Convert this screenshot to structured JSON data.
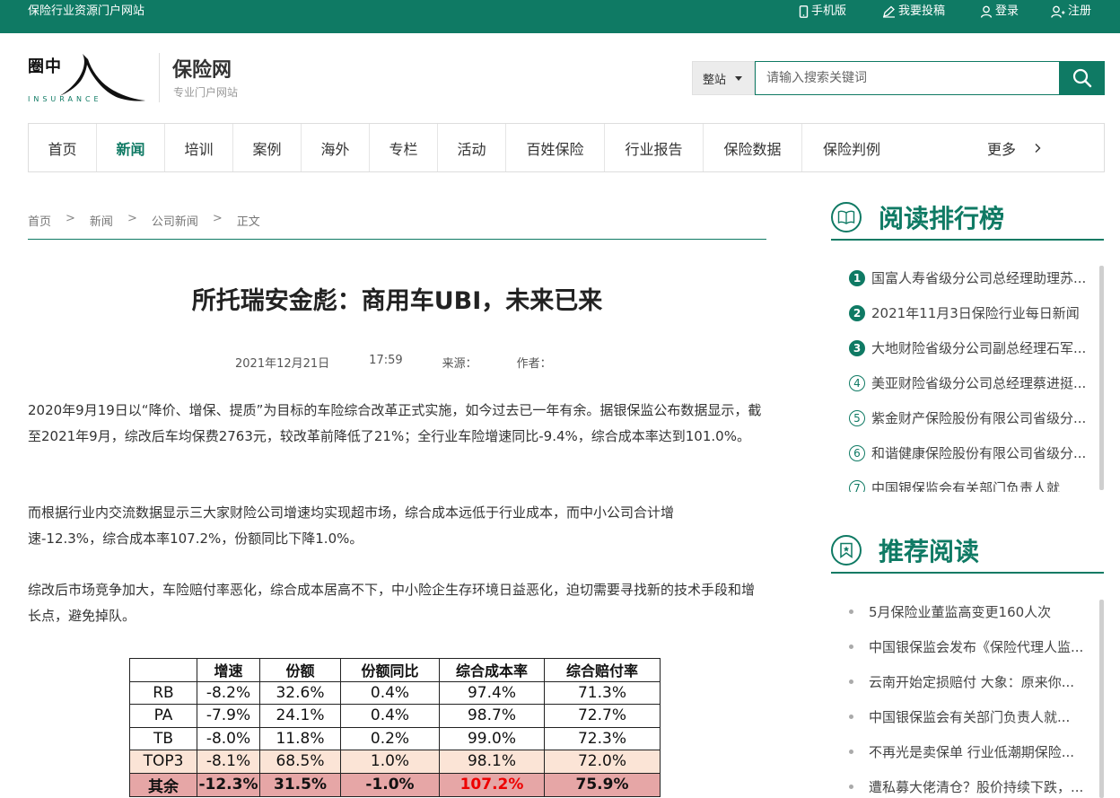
{
  "topbar": {
    "site_name": "保险行业资源门户网站",
    "links": {
      "mobile": "手机版",
      "submit": "我要投稿",
      "login": "登录",
      "register": "注册"
    }
  },
  "header": {
    "logo_text": "圈中",
    "logo_tagline": "INSURANCE",
    "brand_name": "保险网",
    "brand_sub": "专业门户网站"
  },
  "search": {
    "scope": "整站",
    "placeholder": "请输入搜索关键词"
  },
  "nav": {
    "items": [
      "首页",
      "新闻",
      "培训",
      "案例",
      "海外",
      "专栏",
      "活动",
      "百姓保险",
      "行业报告",
      "保险数据",
      "保险判例"
    ],
    "active": "新闻",
    "more": "更多"
  },
  "breadcrumb": {
    "items": [
      "首页",
      "新闻",
      "公司新闻",
      "正文"
    ],
    "separator": ">"
  },
  "article": {
    "title": "所托瑞安金彪：商用车UBI，未来已来",
    "date": "2021年12月21日",
    "time": "17:59",
    "source_label": "来源：",
    "author_label": "作者：",
    "paragraphs": [
      "2020年9月19日以“降价、增保、提质”为目标的车险综合改革正式实施，如今过去已一年有余。据银保监公布数据显示，截至2021年9月，综改后车均保费2763元，较改革前降低了21%；全行业车险增速同比-9.4%，综合成本率达到101.0%。",
      "而根据行业内交流数据显示三大家财险公司增速均实现超市场，综合成本远低于行业成本，而中小公司合计增速-12.3%，综合成本率107.2%，份额同比下降1.0%。",
      "综改后市场竞争加大，车险赔付率恶化，综合成本居高不下，中小险企生存环境日益恶化，迫切需要寻找新的技术手段和增长点，避免掉队。"
    ]
  },
  "table": {
    "headers": [
      "",
      "增速",
      "份额",
      "份额同比",
      "综合成本率",
      "综合赔付率"
    ],
    "rows": [
      [
        "RB",
        "-8.2%",
        "32.6%",
        "0.4%",
        "97.4%",
        "71.3%"
      ],
      [
        "PA",
        "-7.9%",
        "24.1%",
        "0.4%",
        "98.7%",
        "72.7%"
      ],
      [
        "TB",
        "-8.0%",
        "11.8%",
        "0.2%",
        "99.0%",
        "72.3%"
      ],
      [
        "TOP3",
        "-8.1%",
        "68.5%",
        "1.0%",
        "98.1%",
        "72.0%"
      ],
      [
        "其余",
        "-12.3%",
        "31.5%",
        "-1.0%",
        "107.2%",
        "75.9%"
      ]
    ]
  },
  "sidebar": {
    "ranking": {
      "title": "阅读排行榜",
      "items": [
        "国富人寿省级分公司总经理助理苏...",
        "2021年11月3日保险行业每日新闻",
        "大地财险省级分公司副总经理石军...",
        "美亚财险省级分公司总经理蔡进挺...",
        "紫金财产保险股份有限公司省级分...",
        "和谐健康保险股份有限公司省级分...",
        "中国银保监会有关部门负责人就"
      ]
    },
    "recommended": {
      "title": "推荐阅读",
      "items": [
        "5月保险业董监高变更160人次",
        "中国银保监会发布《保险代理人监...",
        "云南开始定损赔付 大象：原来你...",
        "中国银保监会有关部门负责人就...",
        "不再光是卖保单 行业低潮期保险...",
        "遭私募大佬清仓？股价持续下跌，..."
      ]
    }
  },
  "colors": {
    "brand": "#0f7a64",
    "highlight_row": "#fbe4d6",
    "rest_row": "#e6a6a6",
    "alert_text": "#ee0000"
  }
}
